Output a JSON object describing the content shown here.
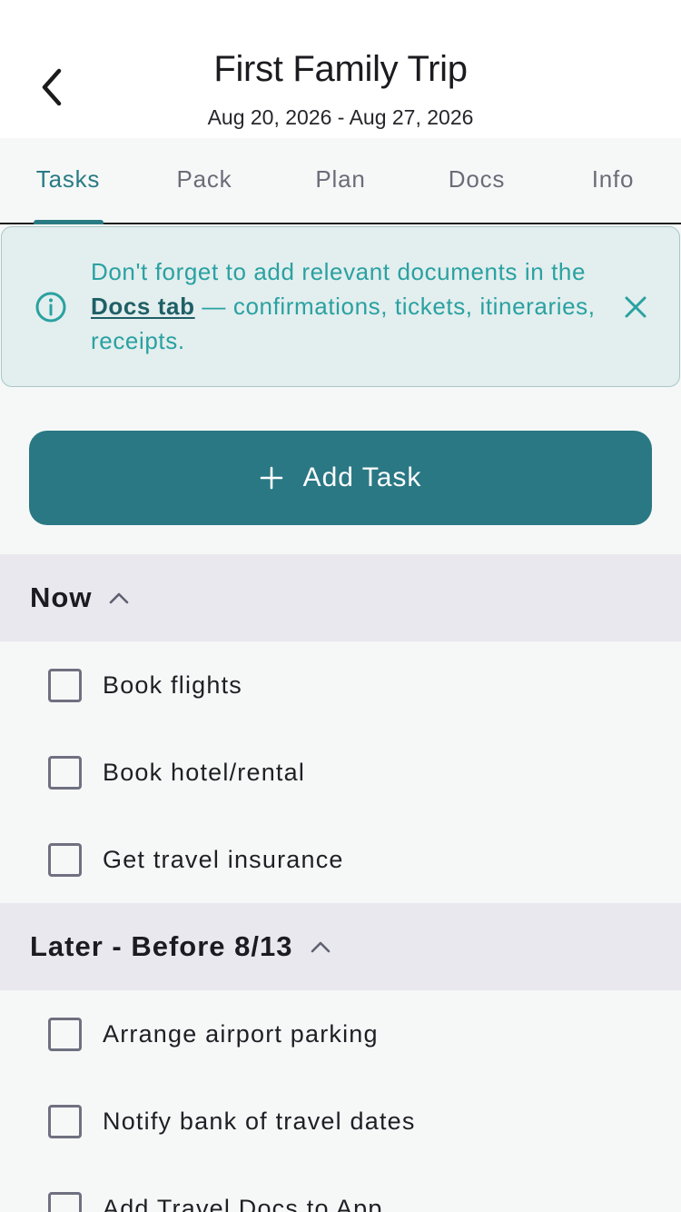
{
  "header": {
    "title": "First Family Trip",
    "date_range": "Aug 20, 2026 - Aug 27, 2026"
  },
  "tabs": [
    {
      "label": "Tasks",
      "active": true
    },
    {
      "label": "Pack",
      "active": false
    },
    {
      "label": "Plan",
      "active": false
    },
    {
      "label": "Docs",
      "active": false
    },
    {
      "label": "Info",
      "active": false
    }
  ],
  "banner": {
    "text_before": "Don't forget to add relevant documents in the ",
    "link_text": "Docs tab",
    "text_after": " — confirmations, tickets, itineraries, receipts."
  },
  "add_task": {
    "label": "Add Task"
  },
  "sections": [
    {
      "title": "Now",
      "tasks": [
        {
          "label": "Book flights",
          "checked": false
        },
        {
          "label": "Book hotel/rental",
          "checked": false
        },
        {
          "label": "Get travel insurance",
          "checked": false
        }
      ]
    },
    {
      "title": "Later - Before 8/13",
      "tasks": [
        {
          "label": "Arrange airport parking",
          "checked": false
        },
        {
          "label": "Notify bank of travel dates",
          "checked": false
        },
        {
          "label": "Add Travel Docs to App",
          "checked": false
        }
      ]
    }
  ],
  "colors": {
    "accent": "#2a7884",
    "banner_bg": "#e3eeee",
    "banner_text": "#2aa1a1",
    "section_bg": "#e9e8ee"
  },
  "icons": {
    "back": "chevron-left-icon",
    "info": "info-circle-icon",
    "close": "close-icon",
    "add": "plus-icon",
    "collapse": "chevron-up-icon"
  }
}
